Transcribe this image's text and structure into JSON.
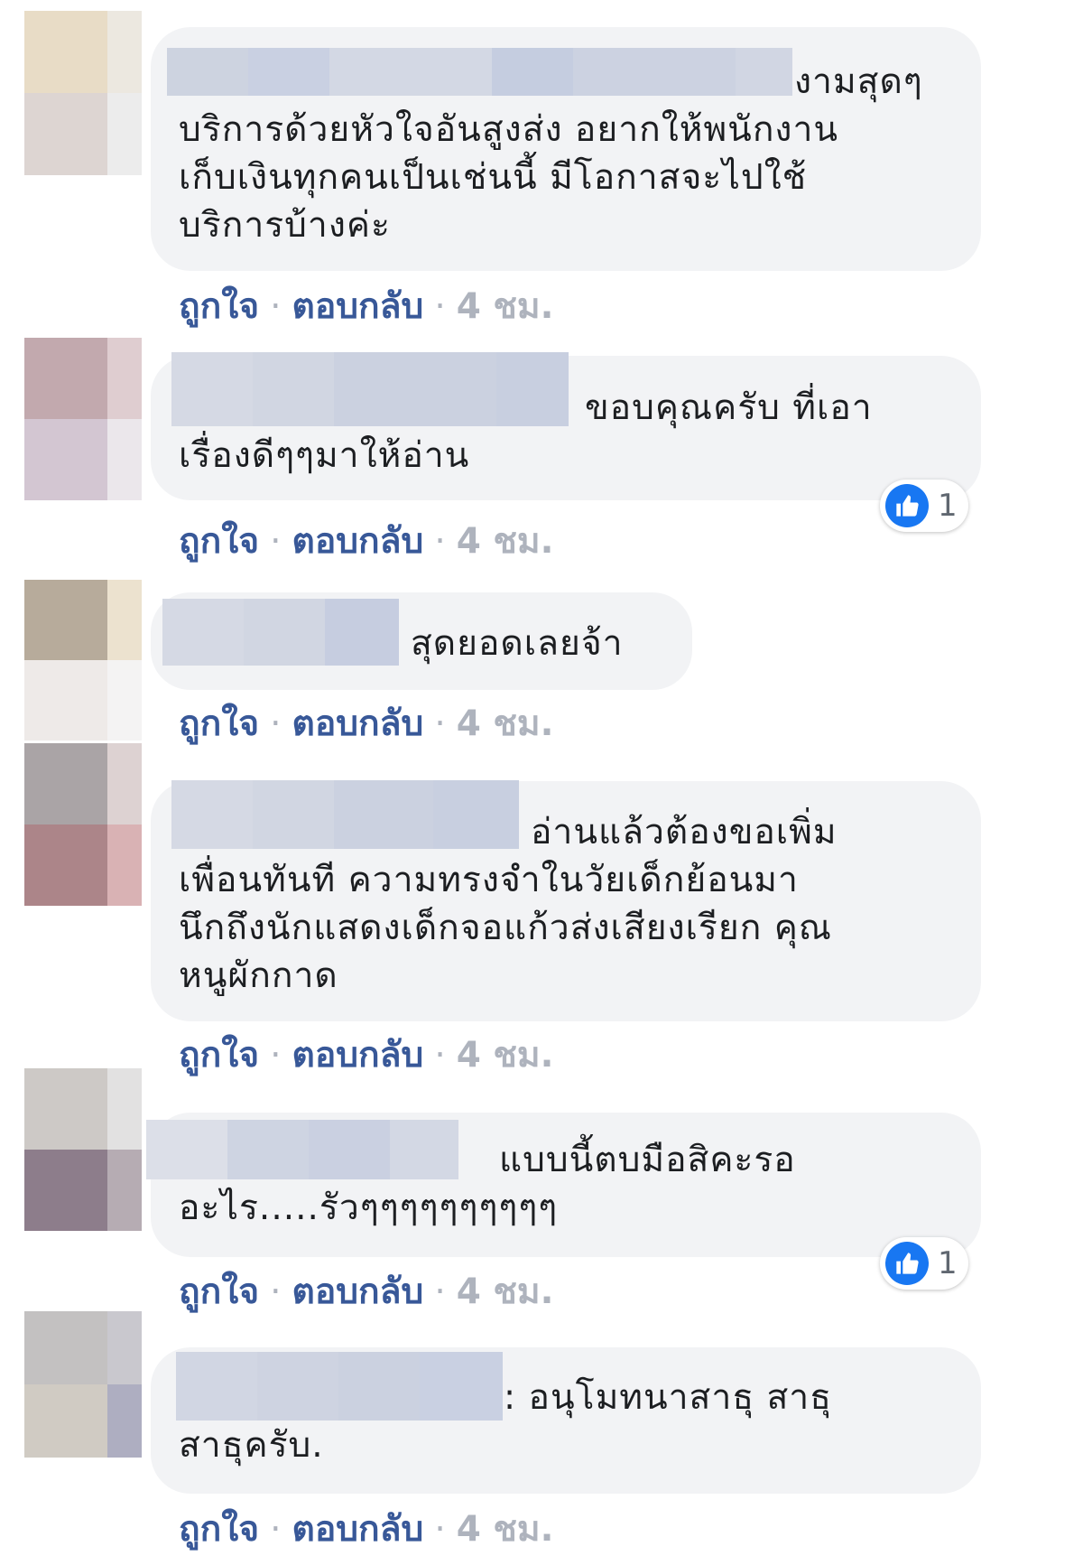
{
  "comments": [
    {
      "text": "งามสุดๆ\nบริการด้วยหัวใจอันสูงส่ง อยากให้พนักงาน\nเก็บเงินทุกคนเป็นเช่นนี้ มีโอกาสจะไปใช้\nบริการบ้างค่ะ",
      "like_label": "ถูกใจ",
      "reply_label": "ตอบกลับ",
      "time": "4 ชม."
    },
    {
      "text": "ขอบคุณครับ ที่เอา\nเรื่องดีๆๆมาให้อ่าน",
      "like_label": "ถูกใจ",
      "reply_label": "ตอบกลับ",
      "time": "4 ชม.",
      "reaction_count": "1"
    },
    {
      "text": "สุดยอดเลยจ้า",
      "like_label": "ถูกใจ",
      "reply_label": "ตอบกลับ",
      "time": "4 ชม."
    },
    {
      "text": "อ่านแล้วต้องขอเพิ่ม\nเพื่อนทันที ความทรงจำในวัยเด็กย้อนมา\nนึกถึงนักแสดงเด็กจอแก้วส่งเสียงเรียก คุณ\nหนูผักกาด",
      "like_label": "ถูกใจ",
      "reply_label": "ตอบกลับ",
      "time": "4 ชม."
    },
    {
      "text": "แบบนี้ตบมือสิคะรอ\nอะไร.....รัวๆๆๆๆๆๆๆๆๆๆ",
      "like_label": "ถูกใจ",
      "reply_label": "ตอบกลับ",
      "time": "4 ชม.",
      "reaction_count": "1"
    },
    {
      "text": ": อนุโมทนาสาธุ สาธุ\nสาธุครับ.",
      "like_label": "ถูกใจ",
      "reply_label": "ตอบกลับ",
      "time": "4 ชม."
    }
  ],
  "colors": {
    "bubble": "#f2f3f5",
    "link": "#385898",
    "meta": "#aeb3bd",
    "like_blue": "#1877f2"
  },
  "icons": {
    "reaction": "thumbs-up-icon"
  }
}
